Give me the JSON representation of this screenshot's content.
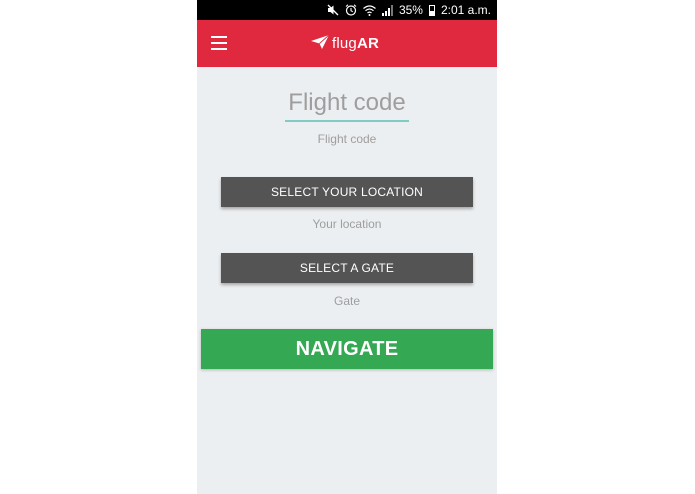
{
  "status_bar": {
    "battery": "35%",
    "time": "2:01 a.m."
  },
  "app_bar": {
    "logo_prefix": "flug",
    "logo_suffix": "AR",
    "color": "#e0293e"
  },
  "flight": {
    "placeholder": "Flight code",
    "helper": "Flight code"
  },
  "location": {
    "button_label": "SELECT YOUR LOCATION",
    "helper": "Your location"
  },
  "gate": {
    "button_label": "SELECT A GATE",
    "helper": "Gate"
  },
  "navigate": {
    "label": "NAVIGATE",
    "color": "#34a853"
  },
  "icons": {
    "status": [
      "mute-icon",
      "alarm-icon",
      "wifi-icon",
      "signal-icon",
      "battery-icon"
    ],
    "menu": "hamburger-menu-icon",
    "logo": "paper-plane-icon"
  }
}
